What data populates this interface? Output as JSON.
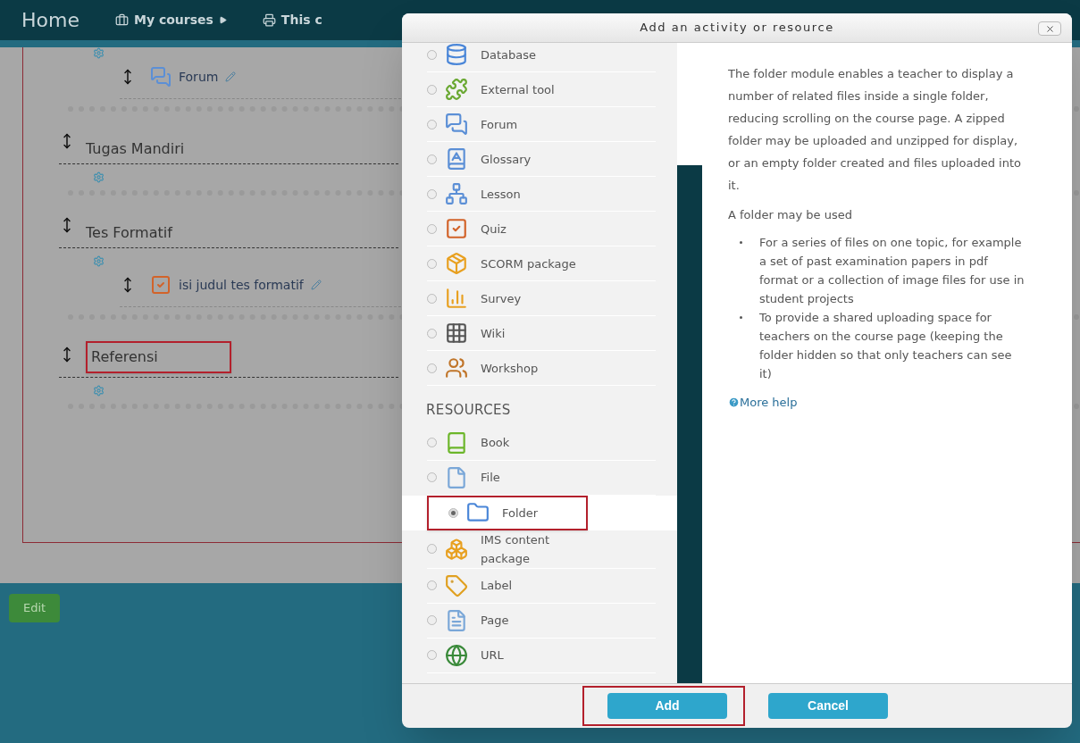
{
  "nav": {
    "brand": "Home",
    "items": [
      {
        "label": "My courses",
        "caret": true
      },
      {
        "label": "This c",
        "caret": false
      }
    ]
  },
  "course": {
    "sections": [
      {
        "activities": [
          {
            "label": "Forum",
            "kind": "forum"
          }
        ]
      },
      {
        "title": "Tugas Mandiri",
        "highlighted": false
      },
      {
        "title": "Tes Formatif",
        "highlighted": false,
        "activities": [
          {
            "label": "isi judul tes formatif",
            "kind": "quiz"
          }
        ]
      },
      {
        "title": "Referensi",
        "highlighted": true
      }
    ]
  },
  "edit_button": "Edit",
  "dialog": {
    "title": "Add an activity or resource",
    "groups": [
      {
        "items": [
          {
            "label": "Database",
            "kind": "database",
            "selected": false,
            "highlighted": false
          },
          {
            "label": "External tool",
            "kind": "puzzle",
            "selected": false,
            "highlighted": false
          },
          {
            "label": "Forum",
            "kind": "forum",
            "selected": false,
            "highlighted": false
          },
          {
            "label": "Glossary",
            "kind": "glossary",
            "selected": false,
            "highlighted": false
          },
          {
            "label": "Lesson",
            "kind": "lesson",
            "selected": false,
            "highlighted": false
          },
          {
            "label": "Quiz",
            "kind": "quiz",
            "selected": false,
            "highlighted": false
          },
          {
            "label": "SCORM package",
            "kind": "scorm",
            "selected": false,
            "highlighted": false
          },
          {
            "label": "Survey",
            "kind": "survey",
            "selected": false,
            "highlighted": false
          },
          {
            "label": "Wiki",
            "kind": "wiki",
            "selected": false,
            "highlighted": false
          },
          {
            "label": "Workshop",
            "kind": "workshop",
            "selected": false,
            "highlighted": false
          }
        ]
      },
      {
        "heading": "RESOURCES",
        "items": [
          {
            "label": "Book",
            "kind": "book",
            "selected": false,
            "highlighted": false
          },
          {
            "label": "File",
            "kind": "file",
            "selected": false,
            "highlighted": false
          },
          {
            "label": "Folder",
            "kind": "folder",
            "selected": true,
            "highlighted": true
          },
          {
            "label": "IMS content package",
            "kind": "ims",
            "selected": false,
            "highlighted": false
          },
          {
            "label": "Label",
            "kind": "label",
            "selected": false,
            "highlighted": false
          },
          {
            "label": "Page",
            "kind": "page",
            "selected": false,
            "highlighted": false
          },
          {
            "label": "URL",
            "kind": "url",
            "selected": false,
            "highlighted": false
          }
        ]
      }
    ],
    "help": {
      "paragraphs": [
        "The folder module enables a teacher to display a number of related files inside a single folder, reducing scrolling on the course page. A zipped folder may be uploaded and unzipped for display, or an empty folder created and files uploaded into it.",
        "A folder may be used"
      ],
      "bullets": [
        "For a series of files on one topic, for example a set of past examination papers in pdf format or a collection of image files for use in student projects",
        "To provide a shared uploading space for teachers on the course page (keeping the folder hidden so that only teachers can see it)"
      ],
      "more_help": "More help"
    },
    "buttons": [
      {
        "label": "Add",
        "highlighted": true
      },
      {
        "label": "Cancel",
        "highlighted": false
      }
    ]
  }
}
